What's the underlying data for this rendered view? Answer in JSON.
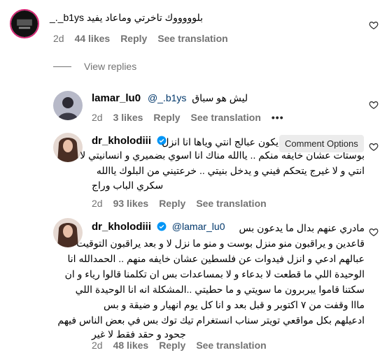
{
  "comments": [
    {
      "text": "بلوووووك تاخرتي وماعاد يفيد b1ys_._",
      "time": "2d",
      "likes": "44 likes",
      "reply": "Reply",
      "translation": "See translation"
    },
    {
      "username": "lamar_lu0",
      "mention": "@_.b1ys",
      "text": "ليش هو سباق",
      "time": "2d",
      "likes": "3 likes",
      "reply": "Reply",
      "translation": "See translation",
      "options": "•••"
    },
    {
      "username": "dr_kholodiii",
      "lines": [
        "يكون عبالج انتي وياها انا انزل",
        "بوستات عشان خايفه منكم .. ياالله مناك انا اسوي بضميري و انسانيتي لا",
        "انتي و لا غيرج يتحكم فيني و يدخل بنيتي .. خرعتيني من البلوك ياالله",
        "سكري الباب وراج"
      ],
      "time": "2d",
      "likes": "93 likes",
      "reply": "Reply",
      "translation": "See translation"
    },
    {
      "username": "dr_kholodiii",
      "mention": "@lamar_lu0",
      "lines": [
        "مادري عنهم بدال ما يدعون بس",
        "قاعدين و يراقبون منو منزل بوست و منو ما نزل لا و بعد يراقبون التوقيت",
        "عبالهم ادعي و انزل فيدوات عن فلسطين عشان خايفه منهم .. الحمدالله انا",
        "الوحيدة اللي ما قطعت لا بدعاء و لا بمساعدات بس ان تكلمنا قالوا رياء و ان",
        "سكتنا قاموا يبربرون ما سويتي و ما حطيتي ..المشكلة انه انا الوحيدة اللي",
        "مااا وقفت من ٧ اكتوبر و قبل بعد و انا كل يوم انهيار و ضيقة و بس",
        "ادعيلهم بكل مواقعي تويتر سناب انستغرام تيك توك بس في بعض الناس فيهم",
        "جحود و حقد فقط لا غير"
      ],
      "time": "2d",
      "likes": "48 likes",
      "reply": "Reply",
      "translation": "See translation"
    }
  ],
  "view_replies": "View replies",
  "tooltip": "Comment Options",
  "colors": {
    "meta": "#737373",
    "mention": "#00376b",
    "verified": "#0095f6"
  }
}
